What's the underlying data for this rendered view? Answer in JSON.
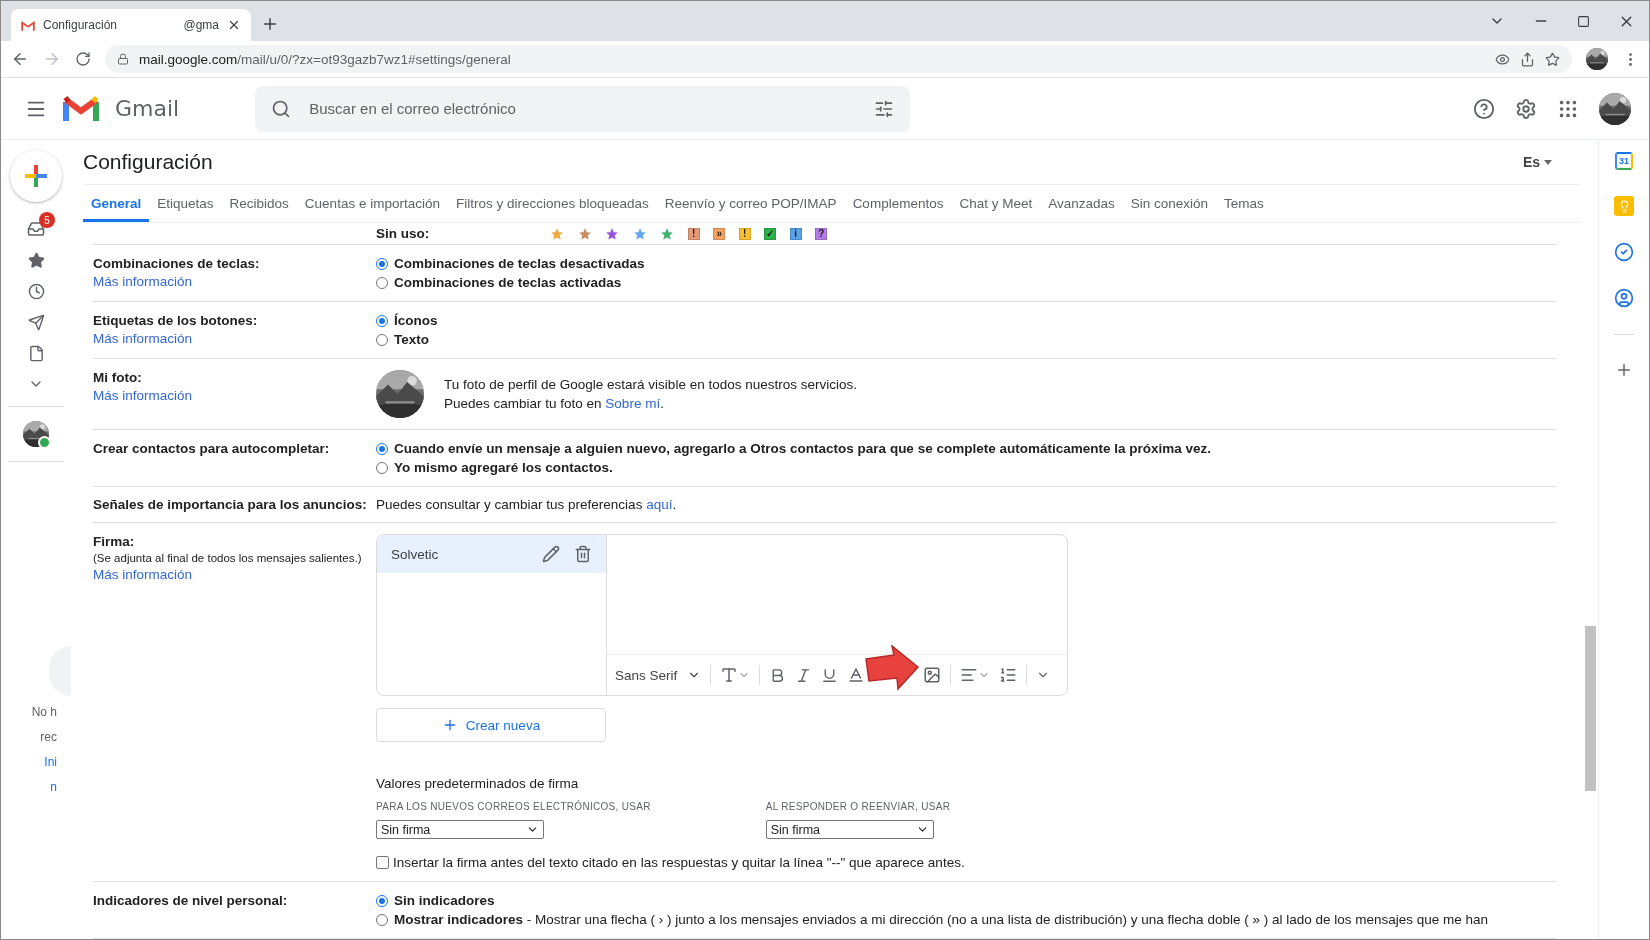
{
  "browser": {
    "tab": {
      "title": "Configuración",
      "title_tail": "@gma"
    },
    "url": {
      "host": "mail.google.com",
      "path": "/mail/u/0/?zx=ot93gazb7wz1#settings/general"
    }
  },
  "header": {
    "product": "Gmail",
    "search": {
      "placeholder": "Buscar en el correo electrónico"
    }
  },
  "left_rail": {
    "inbox_badge": "5",
    "note_lines": [
      {
        "text": "No h",
        "link": false
      },
      {
        "text": "rec",
        "link": false
      },
      {
        "text": "Ini",
        "link": true
      },
      {
        "text": "n",
        "link": true
      }
    ]
  },
  "settings": {
    "title": "Configuración",
    "language": "Es",
    "tabs": [
      {
        "label": "General",
        "selected": true
      },
      {
        "label": "Etiquetas",
        "selected": false
      },
      {
        "label": "Recibidos",
        "selected": false
      },
      {
        "label": "Cuentas e importación",
        "selected": false
      },
      {
        "label": "Filtros y direcciones bloqueadas",
        "selected": false
      },
      {
        "label": "Reenvío y correo POP/IMAP",
        "selected": false
      },
      {
        "label": "Complementos",
        "selected": false
      },
      {
        "label": "Chat y Meet",
        "selected": false
      },
      {
        "label": "Avanzadas",
        "selected": false
      },
      {
        "label": "Sin conexión",
        "selected": false
      },
      {
        "label": "Temas",
        "selected": false
      }
    ],
    "rows": [
      {
        "kind": "markers",
        "label": "Sin uso:",
        "markers": [
          {
            "kind": "star",
            "color": "#f2a93b"
          },
          {
            "kind": "star",
            "color": "#c98a64"
          },
          {
            "kind": "star",
            "color": "#9c4fd8"
          },
          {
            "kind": "star",
            "color": "#5fa8ee"
          },
          {
            "kind": "star",
            "color": "#42b36c"
          },
          {
            "kind": "square",
            "color": "#e69a7a",
            "glyph": "!"
          },
          {
            "kind": "square",
            "color": "#f4a261",
            "glyph": "»"
          },
          {
            "kind": "square",
            "color": "#fbc02d",
            "glyph": "!"
          },
          {
            "kind": "square",
            "color": "#2eb34a",
            "glyph": "✓"
          },
          {
            "kind": "square",
            "color": "#5aa3e8",
            "glyph": "i"
          },
          {
            "kind": "square",
            "color": "#b57be8",
            "glyph": "?"
          }
        ]
      },
      {
        "kind": "radio",
        "label": "Combinaciones de teclas:",
        "link": "Más información",
        "strong": true,
        "options": [
          {
            "text": "Combinaciones de teclas desactivadas",
            "selected": true
          },
          {
            "text": "Combinaciones de teclas activadas",
            "selected": false
          }
        ]
      },
      {
        "kind": "radio",
        "label": "Etiquetas de los botones:",
        "link": "Más información",
        "strong": true,
        "options": [
          {
            "text": "Íconos",
            "selected": true
          },
          {
            "text": "Texto",
            "selected": false
          }
        ]
      },
      {
        "label": "Mi foto:",
        "link": "Más información",
        "line": "Tu foto de perfil de Google estará visible en todos nuestros servicios.",
        "change_text": "Puedes cambiar tu foto en ",
        "change_link": "Sobre mí",
        "change_end": "."
      },
      {
        "kind": "radio",
        "label": "Crear contactos para autocompletar:",
        "strong": true,
        "options": [
          {
            "text": "Cuando envíe un mensaje a alguien nuevo, agregarlo a Otros contactos para que se complete automáticamente la próxima vez.",
            "selected": true
          },
          {
            "text": "Yo mismo agregaré los contactos.",
            "selected": false
          }
        ]
      },
      {
        "kind": "text",
        "label": "Señales de importancia para los anuncios:",
        "text": "Puedes consultar y cambiar tus preferencias ",
        "link_text": "aquí",
        "end": "."
      },
      {
        "kind": "signature",
        "label": "Firma:",
        "note": "(Se adjunta al final de todos los mensajes salientes.)",
        "link": "Más información",
        "signatures": [
          {
            "name": "Solvetic",
            "selected": true
          }
        ],
        "font": "Sans Serif",
        "create": "Crear nueva",
        "defaults_title": "Valores predeterminados de firma",
        "defaults": [
          {
            "label": "PARA LOS NUEVOS CORREOS ELECTRÓNICOS, USAR",
            "value": "Sin firma"
          },
          {
            "label": "AL RESPONDER O REENVIAR, USAR",
            "value": "Sin firma"
          }
        ],
        "insert_option": {
          "label": "Insertar la firma antes del texto citado en las respuestas y quitar la línea \"--\" que aparece antes.",
          "checked": false
        }
      },
      {
        "kind": "radio",
        "label": "Indicadores de nivel personal:",
        "strong": false,
        "options": [
          {
            "text": "**Sin indicadores**",
            "selected": true
          },
          {
            "text": "**Mostrar indicadores** - Mostrar una flecha ( › ) junto a los mensajes enviados a mi dirección (no a una lista de distribución) y una flecha doble ( » ) al lado de los mensajes que me han",
            "selected": false
          }
        ]
      }
    ]
  },
  "right_rail": {
    "calendar_day": "31"
  }
}
